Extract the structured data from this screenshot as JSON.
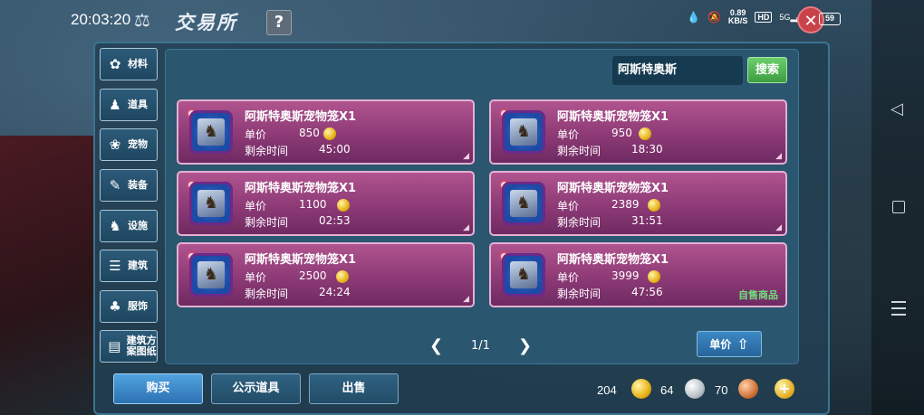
{
  "status_bar": {
    "time": "20:03:20",
    "net_speed_value": "0.89",
    "net_speed_unit": "KB/S",
    "hd_label": "HD",
    "signal_label": "5G",
    "battery": "59"
  },
  "header": {
    "title": "交易所",
    "help_label": "?"
  },
  "categories": [
    {
      "label": "材料",
      "icon": "materials-icon"
    },
    {
      "label": "道具",
      "icon": "items-icon"
    },
    {
      "label": "宠物",
      "icon": "pet-paw-icon"
    },
    {
      "label": "装备",
      "icon": "equipment-icon"
    },
    {
      "label": "设施",
      "icon": "facility-icon"
    },
    {
      "label": "建筑",
      "icon": "building-icon"
    },
    {
      "label": "服饰",
      "icon": "clothing-icon"
    },
    {
      "label": "建筑方案图纸",
      "icon": "blueprint-icon"
    }
  ],
  "search": {
    "value": "阿斯特奥斯",
    "button_label": "搜索"
  },
  "labels": {
    "unit_price": "单价",
    "remaining_time": "剩余时间",
    "self_sale": "自售商品"
  },
  "listings": [
    {
      "name": "阿斯特奥斯宠物笼X1",
      "price": "850",
      "time": "45:00"
    },
    {
      "name": "阿斯特奥斯宠物笼X1",
      "price": "950",
      "time": "18:30"
    },
    {
      "name": "阿斯特奥斯宠物笼X1",
      "price": "1100",
      "time": "02:53"
    },
    {
      "name": "阿斯特奥斯宠物笼X1",
      "price": "2389",
      "time": "31:51"
    },
    {
      "name": "阿斯特奥斯宠物笼X1",
      "price": "2500",
      "time": "24:24"
    },
    {
      "name": "阿斯特奥斯宠物笼X1",
      "price": "3999",
      "time": "47:56"
    }
  ],
  "pagination": {
    "page_text": "1/1"
  },
  "sort": {
    "label": "单价"
  },
  "actions": {
    "buy": "购买",
    "display": "公示道具",
    "sell": "出售"
  },
  "currency": {
    "gold": "204",
    "silver": "64",
    "copper": "70"
  },
  "colors": {
    "card_top": "#b0548f",
    "card_bottom": "#6f2a62",
    "search_button": "#4fb552",
    "buy_button": "#3d8acb",
    "self_sale_text": "#6ee07a"
  }
}
